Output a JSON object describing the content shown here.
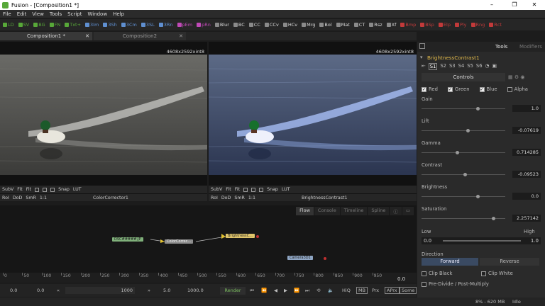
{
  "window": {
    "title": "Fusion - [Composition1 *]",
    "minimize": "–",
    "maximize": "❐",
    "close": "✕"
  },
  "menu": [
    "File",
    "Edit",
    "View",
    "Tools",
    "Script",
    "Window",
    "Help"
  ],
  "toolbar": [
    {
      "label": "LD",
      "color": "#58a839"
    },
    {
      "label": "SV",
      "color": "#58a839"
    },
    {
      "label": "BG",
      "color": "#58a839"
    },
    {
      "label": "FN",
      "color": "#58a839"
    },
    {
      "label": "Txt+",
      "color": "#58a839"
    },
    {
      "label": "3Im",
      "color": "#5f8fd0"
    },
    {
      "label": "3Sh",
      "color": "#5f8fd0"
    },
    {
      "label": "3Cm",
      "color": "#5f8fd0"
    },
    {
      "label": "3SL",
      "color": "#5f8fd0"
    },
    {
      "label": "3Rn",
      "color": "#5f8fd0"
    },
    {
      "label": "pEm",
      "color": "#c04ab7"
    },
    {
      "label": "pRn",
      "color": "#c04ab7"
    },
    {
      "label": "Blur",
      "color": "#8a8a8a"
    },
    {
      "label": "BC",
      "color": "#8a8a8a"
    },
    {
      "label": "CC",
      "color": "#8a8a8a"
    },
    {
      "label": "CCv",
      "color": "#8a8a8a"
    },
    {
      "label": "HCv",
      "color": "#8a8a8a"
    },
    {
      "label": "Mrg",
      "color": "#8a8a8a"
    },
    {
      "label": "Bol",
      "color": "#8a8a8a"
    },
    {
      "label": "Mat",
      "color": "#8a8a8a"
    },
    {
      "label": "CT",
      "color": "#8a8a8a"
    },
    {
      "label": "Rsz",
      "color": "#8a8a8a"
    },
    {
      "label": "Xf",
      "color": "#8a8a8a"
    },
    {
      "label": "Bmp",
      "color": "#c23a3a"
    },
    {
      "label": "BSp",
      "color": "#c23a3a"
    },
    {
      "label": "Elp",
      "color": "#c23a3a"
    },
    {
      "label": "Ply",
      "color": "#c23a3a"
    },
    {
      "label": "Rng",
      "color": "#c23a3a"
    },
    {
      "label": "Rct",
      "color": "#c23a3a"
    }
  ],
  "tabs": [
    {
      "label": "Composition1 *"
    },
    {
      "label": "Composition2"
    }
  ],
  "viewers": [
    {
      "resolution": "4608x2592xint8",
      "subv": "SubV",
      "fit1": "Fit",
      "fit2": "Fit",
      "snap": "Snap",
      "lut": "LUT",
      "roi": "RoI",
      "dod": "DoD",
      "smr": "SmR",
      "ratio": "1:1",
      "node": "ColorCorrector1"
    },
    {
      "resolution": "4608x2592xint8",
      "subv": "SubV",
      "fit1": "Fit",
      "fit2": "Fit",
      "snap": "Snap",
      "lut": "LUT",
      "roi": "RoI",
      "dod": "DoD",
      "smr": "SmR",
      "ratio": "1:1",
      "node": "BrightnessContrast1"
    }
  ],
  "flowtabs": [
    "Flow",
    "Console",
    "Timeline",
    "Spline"
  ],
  "nodes": [
    {
      "label": "DSC#####.JP",
      "color": "#7fb07a"
    },
    {
      "label": "ColorCorrec...",
      "color": "#8c8c8c"
    },
    {
      "label": "BrightnessC...",
      "color": "#e0c56b"
    },
    {
      "label": "Camera3D1",
      "color": "#8fa6c4"
    }
  ],
  "timeline": {
    "ticks": [
      "0",
      "50",
      "100",
      "150",
      "200",
      "250",
      "300",
      "350",
      "400",
      "450",
      "500",
      "550",
      "600",
      "650",
      "700",
      "750",
      "800",
      "850",
      "900",
      "950"
    ],
    "current": "0.0"
  },
  "transport": {
    "start": "0.0",
    "render_start": "0.0",
    "range_end": "1000",
    "end_label": "5.0",
    "end": "1000.0",
    "render": "Render",
    "hiq": "HiQ",
    "mb": "MB",
    "prx": "Prx",
    "aprx": "APrx",
    "some": "Some"
  },
  "status": {
    "memory": "8% - 620 MB",
    "state": "Idle"
  },
  "panel": {
    "tabs": [
      "Tools",
      "Modifiers"
    ],
    "tool_name": "BrightnessContrast1",
    "slots": [
      "S1",
      "S2",
      "S3",
      "S4",
      "S5",
      "S6"
    ],
    "section": "Controls",
    "channels": [
      {
        "label": "Red",
        "checked": true
      },
      {
        "label": "Green",
        "checked": true
      },
      {
        "label": "Blue",
        "checked": true
      },
      {
        "label": "Alpha",
        "checked": false
      }
    ],
    "params": [
      {
        "label": "Gain",
        "value": "1.0",
        "pos": 0.67
      },
      {
        "label": "Lift",
        "value": "-0.07619",
        "pos": 0.55
      },
      {
        "label": "Gamma",
        "value": "0.714285",
        "pos": 0.42
      },
      {
        "label": "Contrast",
        "value": "-0.09523",
        "pos": 0.52
      },
      {
        "label": "Brightness",
        "value": "0.0",
        "pos": 0.67
      },
      {
        "label": "Saturation",
        "value": "2.257142",
        "pos": 0.86
      }
    ],
    "low_label": "Low",
    "high_label": "High",
    "low_value": "0.0",
    "high_value": "1.0",
    "direction_label": "Direction",
    "forward": "Forward",
    "reverse": "Reverse",
    "clip_black": "Clip Black",
    "clip_white": "Clip White",
    "predivide": "Pre-Divide / Post-Multiply"
  }
}
